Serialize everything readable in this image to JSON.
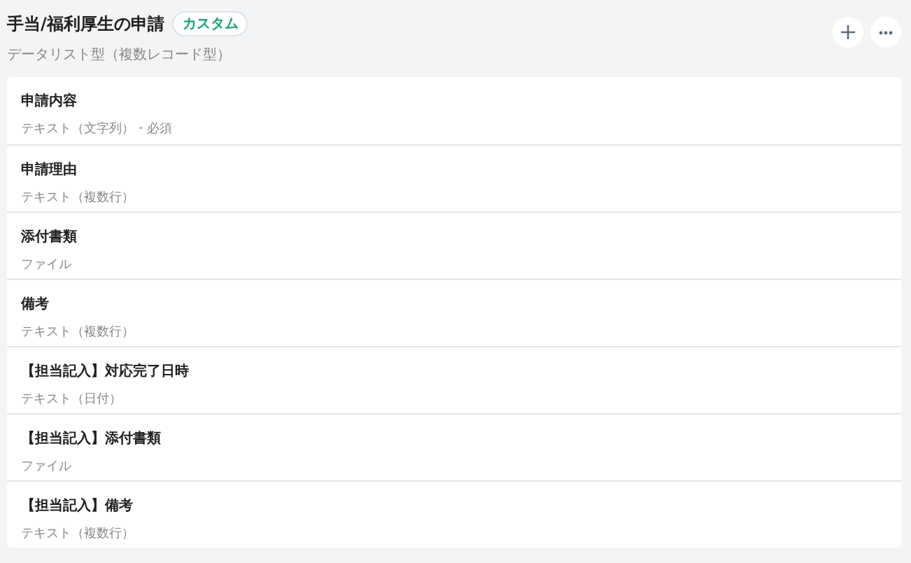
{
  "header": {
    "title": "手当/福利厚生の申請",
    "badge": "カスタム",
    "subtitle": "データリスト型（複数レコード型）"
  },
  "fields": [
    {
      "name": "申請内容",
      "type": "テキスト（文字列）・必須"
    },
    {
      "name": "申請理由",
      "type": "テキスト（複数行）"
    },
    {
      "name": "添付書類",
      "type": "ファイル"
    },
    {
      "name": "備考",
      "type": "テキスト（複数行）"
    },
    {
      "name": "【担当記入】対応完了日時",
      "type": "テキスト（日付）"
    },
    {
      "name": "【担当記入】添付書類",
      "type": "ファイル"
    },
    {
      "name": "【担当記入】備考",
      "type": "テキスト（複数行）"
    }
  ]
}
